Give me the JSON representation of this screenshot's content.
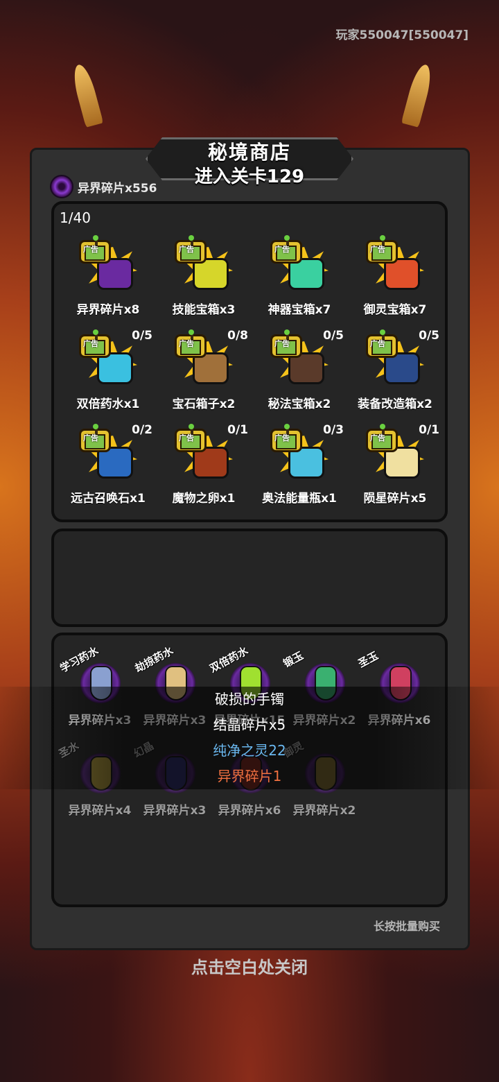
{
  "player": {
    "label": "玩家550047[550047]"
  },
  "shop": {
    "title": "秘境商店",
    "overlay": "进入关卡129"
  },
  "currency": {
    "label": "异界碎片x556",
    "icon": "void-swirl-icon"
  },
  "ad_section": {
    "counter": "1/40",
    "badge": "广告",
    "items": [
      {
        "name": "异界碎片x8",
        "limit": "",
        "color": "#6a2aa0"
      },
      {
        "name": "技能宝箱x3",
        "limit": "",
        "color": "#d6d62a"
      },
      {
        "name": "神器宝箱x7",
        "limit": "",
        "color": "#3ad0a0"
      },
      {
        "name": "御灵宝箱x7",
        "limit": "",
        "color": "#e0502a"
      },
      {
        "name": "双倍药水x1",
        "limit": "0/5",
        "color": "#3ac0e0"
      },
      {
        "name": "宝石箱子x2",
        "limit": "0/8",
        "color": "#a0703a"
      },
      {
        "name": "秘法宝箱x2",
        "limit": "0/5",
        "color": "#5a3a2a"
      },
      {
        "name": "装备改造箱x2",
        "limit": "0/5",
        "color": "#2a4a8a"
      },
      {
        "name": "远古召唤石x1",
        "limit": "0/2",
        "color": "#2a6ac0"
      },
      {
        "name": "魔物之卵x1",
        "limit": "0/1",
        "color": "#a03a1a"
      },
      {
        "name": "奥法能量瓶x1",
        "limit": "0/3",
        "color": "#4ac0e0"
      },
      {
        "name": "陨星碎片x5",
        "limit": "0/1",
        "color": "#f0e0a0"
      }
    ]
  },
  "shop_items": [
    {
      "tag": "学习药水",
      "price": "异界碎片x3",
      "color": "#8aa0d0"
    },
    {
      "tag": "劫掠药水",
      "price": "异界碎片x3",
      "color": "#e0c080"
    },
    {
      "tag": "双倍药水",
      "price": "异界碎片x15",
      "color": "#a0e030"
    },
    {
      "tag": "锻玉",
      "price": "异界碎片x2",
      "color": "#3ab070"
    },
    {
      "tag": "圣玉",
      "price": "异界碎片x6",
      "color": "#d04060"
    },
    {
      "tag": "圣水",
      "price": "异界碎片x4",
      "color": "#e0c040"
    },
    {
      "tag": "幻晶",
      "price": "异界碎片x3",
      "color": "#3a3aa0"
    },
    {
      "tag": "",
      "price": "异界碎片x6",
      "color": "#c03020"
    },
    {
      "tag": "御灵",
      "price": "异界碎片x2",
      "color": "#c0a040"
    }
  ],
  "toasts": [
    {
      "text": "破损的手镯",
      "color": "#ffffff"
    },
    {
      "text": "结晶碎片x5",
      "color": "#ffffff"
    },
    {
      "text": "纯净之灵22",
      "color": "#6ab8f0"
    },
    {
      "text": "异界碎片1",
      "color": "#f07040"
    }
  ],
  "hints": {
    "long_press": "长按批量购买",
    "close": "点击空白处关闭"
  }
}
